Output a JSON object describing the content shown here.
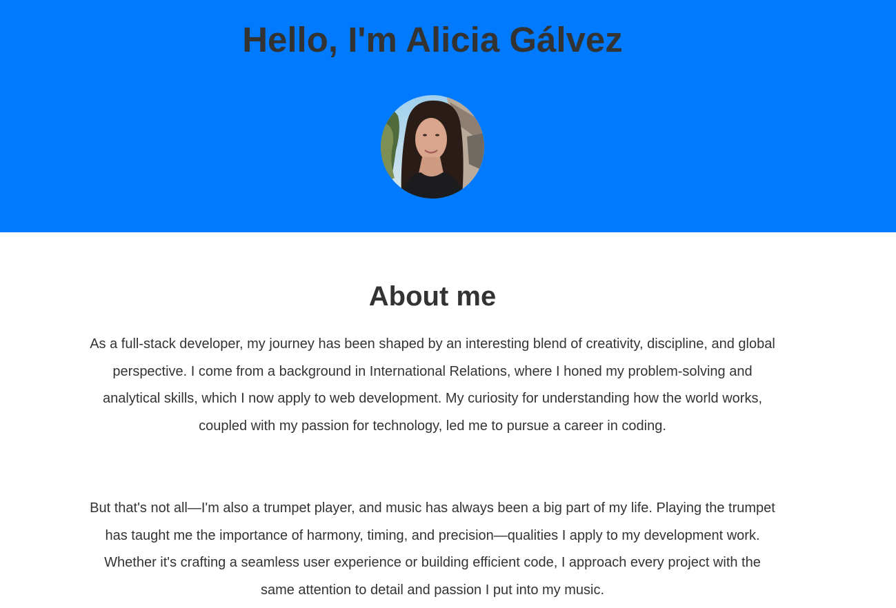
{
  "hero": {
    "title": "Hello, I'm Alicia Gálvez",
    "background_color": "#007bff"
  },
  "about": {
    "heading": "About me",
    "paragraphs": [
      "As a full-stack developer, my journey has been shaped by an interesting blend of creativity, discipline, and global perspective. I come from a background in International Relations, where I honed my problem-solving and analytical skills, which I now apply to web development. My curiosity for understanding how the world works, coupled with my passion for technology, led me to pursue a career in coding.",
      "But that's not all—I'm also a trumpet player, and music has always been a big part of my life. Playing the trumpet has taught me the importance of harmony, timing, and precision—qualities I apply to my development work. Whether it's crafting a seamless user experience or building efficient code, I approach every project with the same attention to detail and passion I put into my music."
    ]
  }
}
